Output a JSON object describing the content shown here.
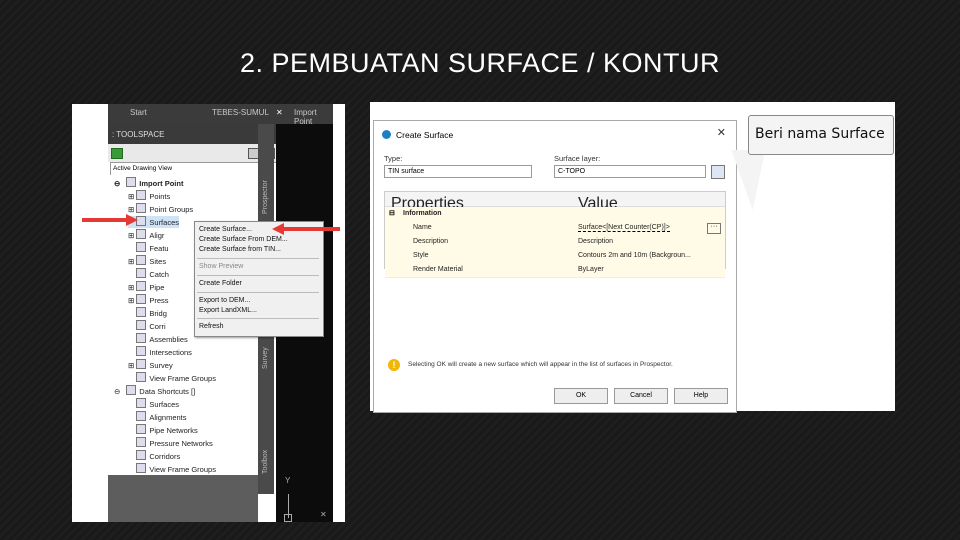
{
  "slide": {
    "title": "2. PEMBUATAN SURFACE / KONTUR"
  },
  "acad": {
    "tabs": [
      "Start",
      "TEBES-SUMUL",
      "Import Point"
    ],
    "toolspace_title": ": TOOLSPACE",
    "view_dropdown": "Active Drawing View",
    "side_tabs": [
      "Prospector",
      "Survey",
      "Toolbox"
    ],
    "tree": [
      {
        "label": "Import Point",
        "bold": true
      },
      {
        "label": "Points"
      },
      {
        "label": "Point Groups"
      },
      {
        "label": "Surfaces"
      },
      {
        "label": "Aligr"
      },
      {
        "label": "Featu"
      },
      {
        "label": "Sites"
      },
      {
        "label": "Catch"
      },
      {
        "label": "Pipe"
      },
      {
        "label": "Press"
      },
      {
        "label": "Bridg"
      },
      {
        "label": "Corri"
      },
      {
        "label": "Assemblies"
      },
      {
        "label": "Intersections"
      },
      {
        "label": "Survey"
      },
      {
        "label": "View Frame Groups"
      },
      {
        "label": "Data Shortcuts []"
      },
      {
        "label": "Surfaces"
      },
      {
        "label": "Alignments"
      },
      {
        "label": "Pipe Networks"
      },
      {
        "label": "Pressure Networks"
      },
      {
        "label": "Corridors"
      },
      {
        "label": "View Frame Groups"
      }
    ],
    "context_menu": {
      "items": [
        "Create Surface...",
        "Create Surface From DEM...",
        "Create Surface from TIN...",
        "Show Preview",
        "Create Folder",
        "Export to DEM...",
        "Export LandXML...",
        "Refresh"
      ]
    },
    "axis_label": "Y"
  },
  "dialog": {
    "title": "Create Surface",
    "type_label": "Type:",
    "type_value": "TIN surface",
    "layer_label": "Surface layer:",
    "layer_value": "C-TOPO",
    "grid_headers": [
      "Properties",
      "Value"
    ],
    "section": "Information",
    "rows": [
      {
        "prop": "Name",
        "value": "Surface<[Next Counter(CP)]>"
      },
      {
        "prop": "Description",
        "value": "Description"
      },
      {
        "prop": "Style",
        "value": "Contours 2m and 10m (Backgroun..."
      },
      {
        "prop": "Render Material",
        "value": "ByLayer"
      }
    ],
    "info_text": "Selecting OK will create a new surface which will appear in the list of surfaces in Prospector.",
    "buttons": {
      "ok": "OK",
      "cancel": "Cancel",
      "help": "Help"
    }
  },
  "callout": {
    "text": "Beri nama Surface"
  },
  "colors": {
    "arrow": "#e53935",
    "background": "#1b1b1b"
  }
}
